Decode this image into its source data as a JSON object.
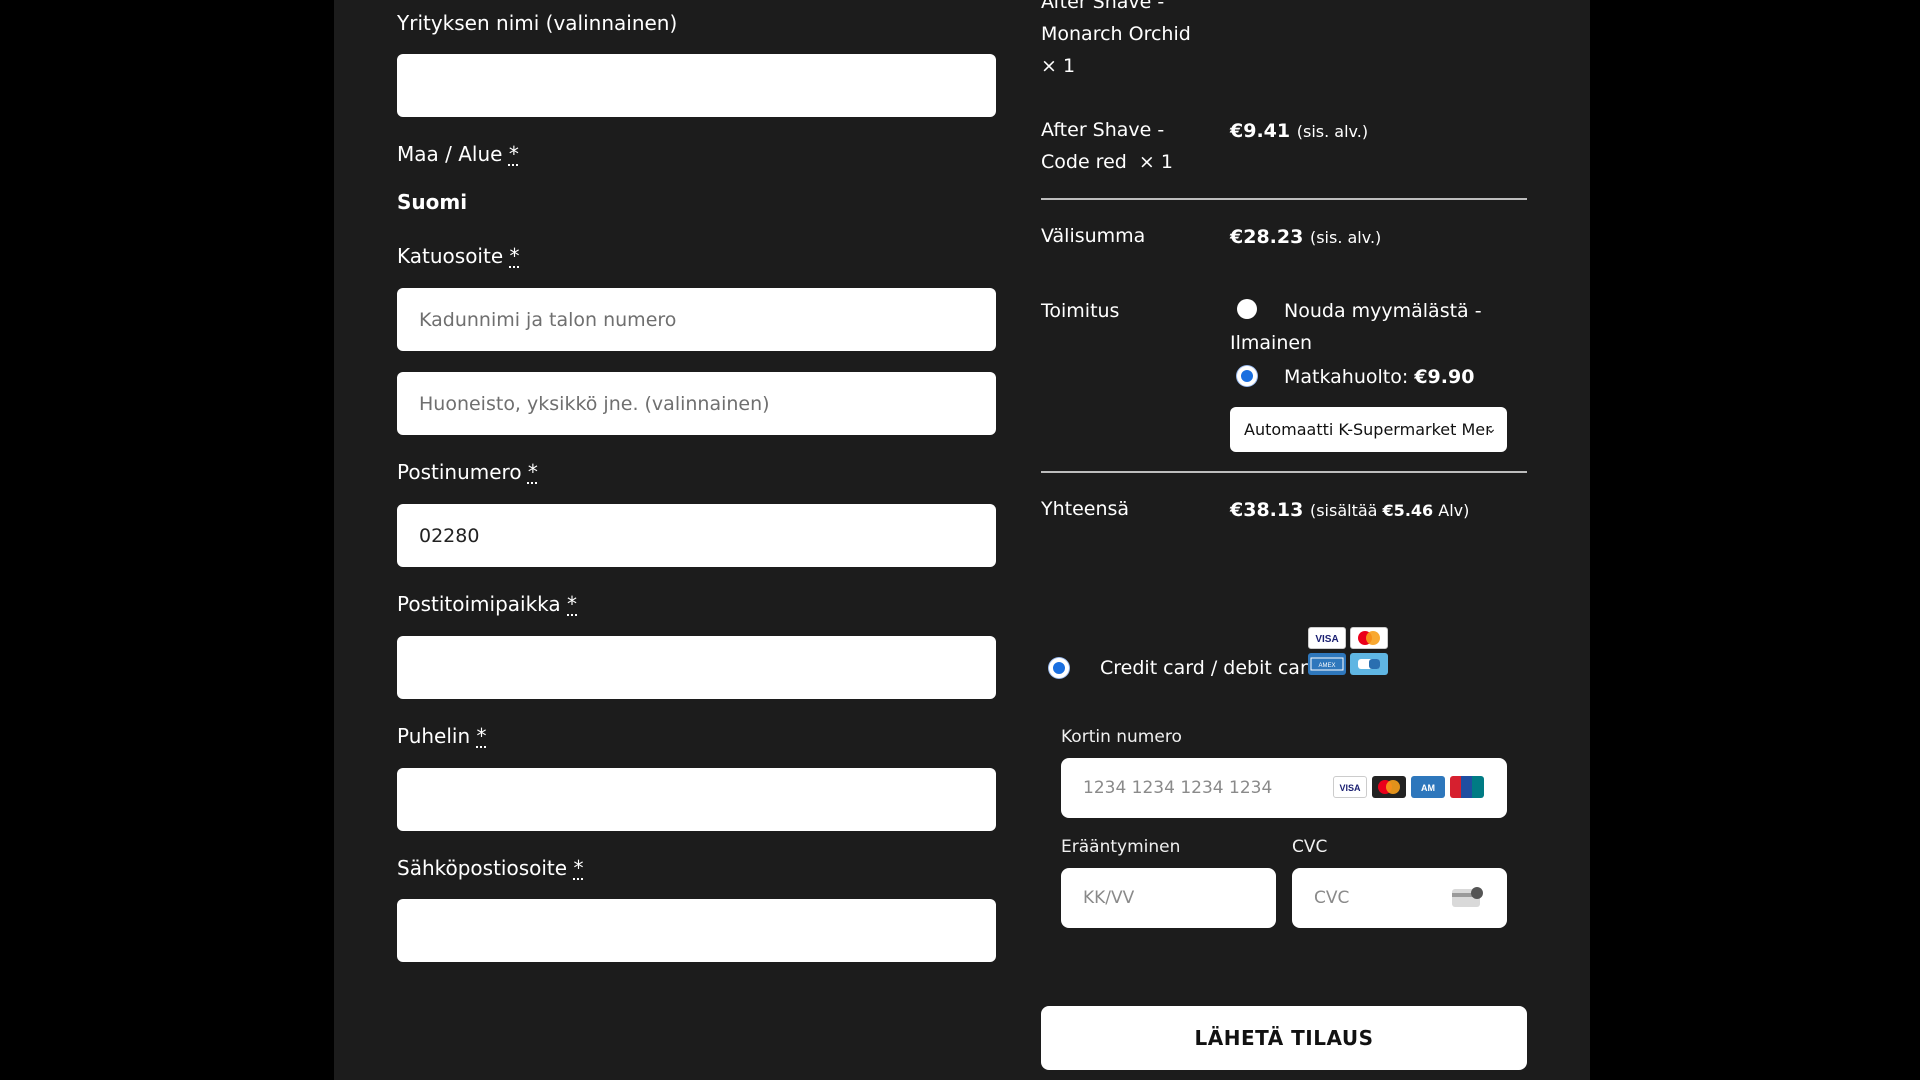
{
  "billing": {
    "company_label": "Yrityksen nimi (valinnainen)",
    "country_label": "Maa / Alue",
    "country_value": "Suomi",
    "street_label": "Katuosoite",
    "street_placeholder": "Kadunnimi ja talon numero",
    "street2_placeholder": "Huoneisto, yksikkö jne. (valinnainen)",
    "postcode_label": "Postinumero",
    "postcode_value": "02280",
    "city_label": "Postitoimipaikka",
    "phone_label": "Puhelin",
    "email_label": "Sähköpostiosoite",
    "required_mark": "*"
  },
  "summary": {
    "item1_name_line1": "After Shave -",
    "item1_name_line2": "Monarch Orchid",
    "item1_qty": "× 1",
    "item2_name_line1": "After Shave -",
    "item2_name_line2": "Code red",
    "item2_qty": "× 1",
    "item2_price": "€9.41",
    "incl_vat": "(sis. alv.)",
    "subtotal_label": "Välisumma",
    "subtotal_value": "€28.23",
    "shipping_label": "Toimitus",
    "shipping_option1_line1": "Nouda myymälästä -",
    "shipping_option1_line2": "Ilmainen",
    "shipping_option2_label": "Matkahuolto:",
    "shipping_option2_price": "€9.90",
    "pickup_point": "Automaatti K-Supermarket Mer",
    "total_label": "Yhteensä",
    "total_value": "€38.13",
    "total_vat_prefix": "(sisältää",
    "total_vat_amount": "€5.46",
    "total_vat_suffix": "Alv)"
  },
  "payment": {
    "method_label": "Credit card / debit card",
    "card_number_label": "Kortin numero",
    "card_number_placeholder": "1234 1234 1234 1234",
    "expiry_label": "Erääntyminen",
    "expiry_placeholder": "KK/VV",
    "cvc_label": "CVC",
    "cvc_placeholder": "CVC",
    "brands": [
      "VISA",
      "Mastercard",
      "American Express",
      "UnionPay"
    ],
    "submit_label": "LÄHETÄ TILAUS"
  },
  "colors": {
    "radio_selected": "#1a6fe0",
    "panel_bg": "#1c1c1c"
  }
}
